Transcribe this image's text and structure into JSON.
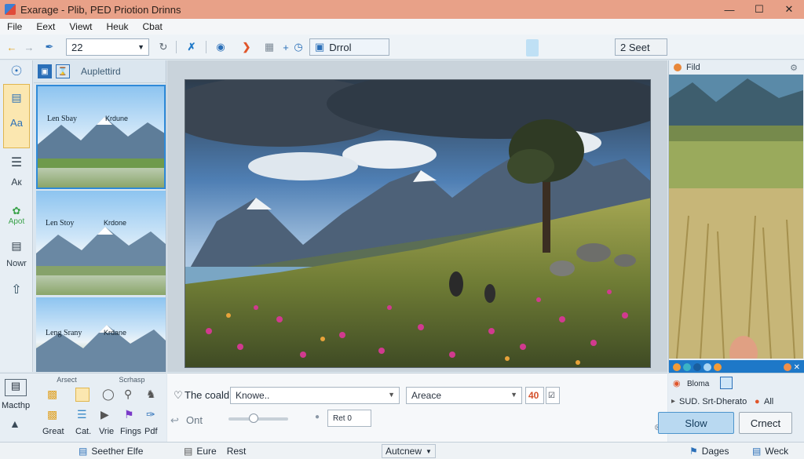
{
  "window": {
    "title": "Exarage - Plib, PED Priotion Drinns",
    "controls": {
      "minimize": "—",
      "maximize": "☐",
      "close": "✕"
    }
  },
  "menu": [
    "File",
    "Eext",
    "Viewt",
    "Heuk",
    "Cbat"
  ],
  "toolbar": {
    "zoom_value": "22",
    "mode_label": "Drrol",
    "right_field": "2 Seet"
  },
  "rail": {
    "items": [
      "Aк",
      "Apot",
      "Nowr"
    ]
  },
  "thumbs": {
    "header": "Auplettird",
    "items": [
      {
        "left": "Len Sbay",
        "right": "Krdune"
      },
      {
        "left": "Len Stoy",
        "right": "Krdone"
      },
      {
        "left": "Leng Srany",
        "right": "Krdane"
      }
    ]
  },
  "right_panel": {
    "header": "Fild"
  },
  "left_bottom": {
    "label_a": "Arsect",
    "label_b": "Scrhasp",
    "tools_left": "Macthp",
    "tools": [
      "Great",
      "Cat.",
      "Vrie",
      "Fings",
      "Pdf"
    ]
  },
  "center_bottom": {
    "row1_label": "The coald",
    "row1_field": "Knowe..",
    "row1_field2": "Areace",
    "row1_num": "40",
    "row2_label": "Ont",
    "row2_field": "Ret  0"
  },
  "right_bottom": {
    "line1": "Bloma",
    "line2": "SUD. Srt-Dherato",
    "line2b": "All",
    "btn_primary": "Slow",
    "btn_secondary": "Crnect"
  },
  "status": {
    "left": "Seether Elfe",
    "mid1": "Eure",
    "mid2": "Rest",
    "mid3": "Autcnew",
    "right1": "Dages",
    "right2": "Weck"
  },
  "colors": {
    "titlebar": "#e8a188",
    "accent": "#1e78c8",
    "selection": "#fbe7b0",
    "primary_button": "#b9d9f1"
  }
}
